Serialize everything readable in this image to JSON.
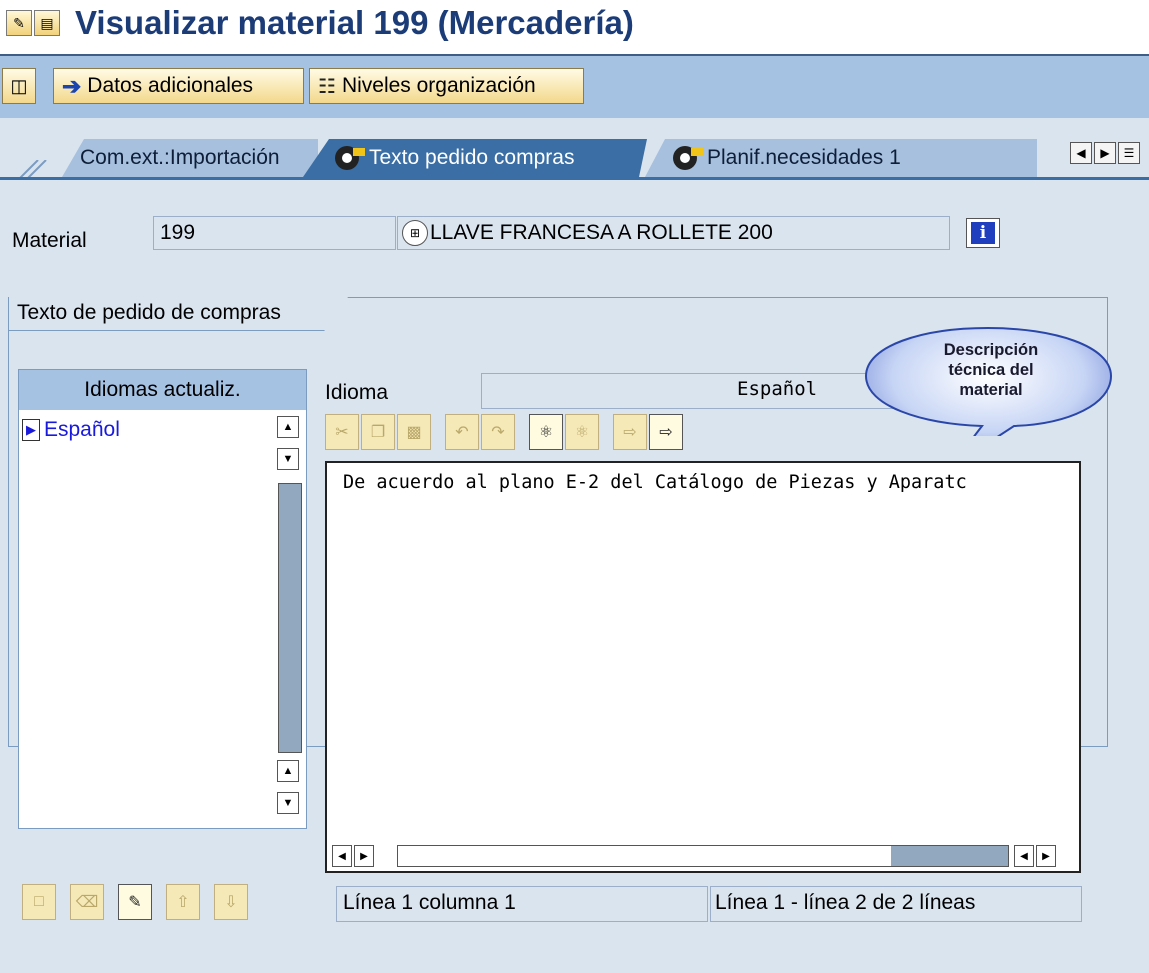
{
  "window": {
    "title": "Visualizar material 199 (Mercadería)"
  },
  "app_toolbar": {
    "datos_label": "Datos adicionales",
    "niveles_label": "Niveles organización"
  },
  "tabs": [
    {
      "label": "Com.ext.:Importación",
      "active": false
    },
    {
      "label": "Texto pedido compras",
      "active": true
    },
    {
      "label": "Planif.necesidades 1",
      "active": false
    }
  ],
  "material": {
    "label": "Material",
    "number": "199",
    "description": "LLAVE FRANCESA A ROLLETE 200"
  },
  "group": {
    "title": "Texto de pedido de compras"
  },
  "languages": {
    "header": "Idiomas actualiz.",
    "items": [
      "Español"
    ]
  },
  "idioma": {
    "label": "Idioma",
    "value": "Español"
  },
  "editor": {
    "text": "De acuerdo al plano E-2 del Catálogo de Piezas y Aparatc"
  },
  "status": {
    "left": "Línea 1 columna 1",
    "right": "Línea 1 - línea 2 de 2 líneas"
  },
  "callout": {
    "line1": "Descripción",
    "line2": "técnica del",
    "line3": "material"
  },
  "colors": {
    "title": "#1c3c78",
    "toolbar_bg": "#a6c2e3",
    "active_tab": "#3a6ea5",
    "link_blue": "#1a1adc"
  }
}
